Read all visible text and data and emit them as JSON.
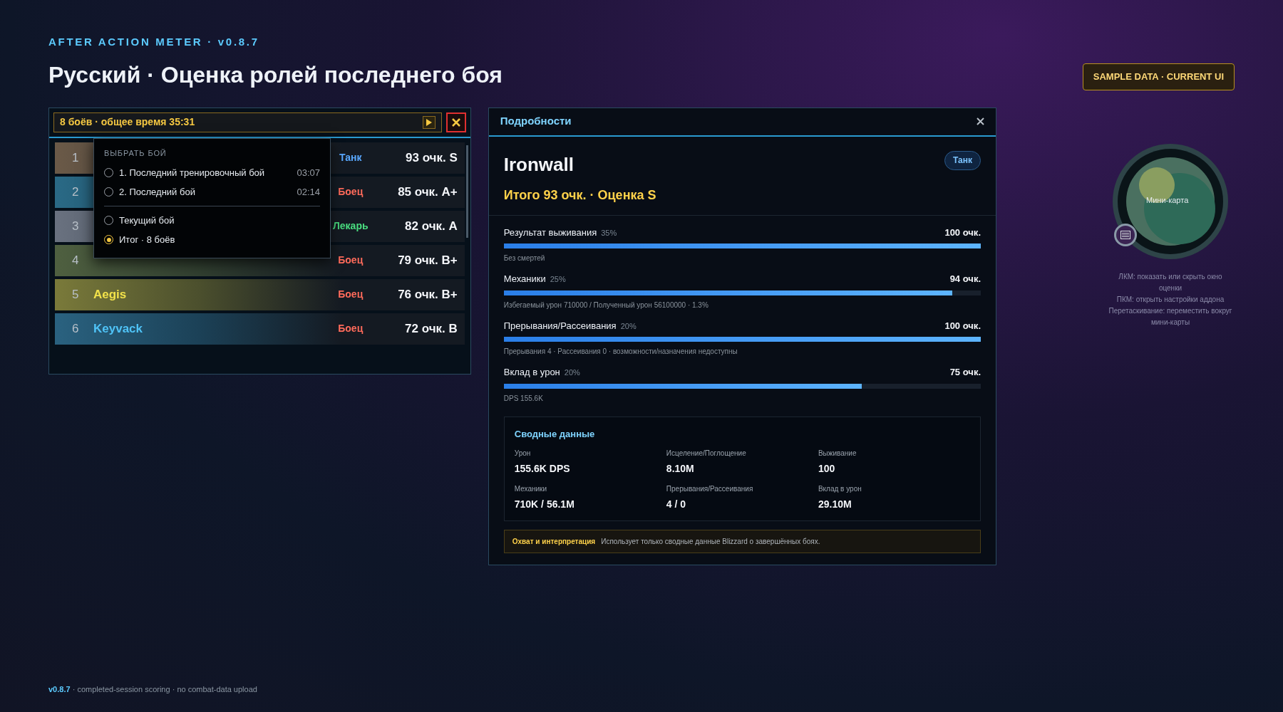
{
  "header": {
    "eyebrow": "AFTER ACTION METER · v0.8.7",
    "title": "Русский · Оценка ролей последнего боя",
    "badge": "SAMPLE DATA · CURRENT UI"
  },
  "meter": {
    "summary": "8 боёв · общее время 35:31",
    "rows": [
      {
        "rank": "1",
        "role": {
          "text": "Танк",
          "color": "#5aa9ff"
        },
        "score": "93 очк. S",
        "color": "#6b5a48"
      },
      {
        "rank": "2",
        "role": {
          "text": "Боец",
          "color": "#ff6b5b"
        },
        "score": "85 очк. A+",
        "color": "#2a6a86"
      },
      {
        "rank": "3",
        "role": {
          "text": "Лекарь",
          "color": "#4ade80"
        },
        "score": "82 очк. A",
        "color": "#6a7280"
      },
      {
        "rank": "4",
        "role": {
          "text": "Боец",
          "color": "#ff6b5b"
        },
        "score": "79 очк. B+",
        "color": "#4f6040"
      },
      {
        "rank": "5",
        "name": {
          "text": "Aegis",
          "color": "#f2e24a"
        },
        "role": {
          "text": "Боец",
          "color": "#ff6b5b"
        },
        "score": "76 очк. B+",
        "color": "#7a7a3a"
      },
      {
        "rank": "6",
        "name": {
          "text": "Keyvack",
          "color": "#4fc3f7"
        },
        "role": {
          "text": "Боец",
          "color": "#ff6b5b"
        },
        "score": "72 очк. B",
        "color": "#2a6280"
      }
    ],
    "dropdown": {
      "heading": "ВЫБРАТЬ БОЙ",
      "groups": [
        [
          {
            "label": "1. Последний тренировочный бой",
            "time": "03:07",
            "selected": false
          },
          {
            "label": "2. Последний бой",
            "time": "02:14",
            "selected": false
          }
        ],
        [
          {
            "label": "Текущий бой",
            "selected": false
          },
          {
            "label": "Итог · 8 боёв",
            "selected": true
          }
        ]
      ]
    }
  },
  "details": {
    "title": "Подробности",
    "player": "Ironwall",
    "role": "Танк",
    "total": "Итого 93 очк. · Оценка S",
    "metrics": [
      {
        "label": "Результат выживания",
        "weight": "35%",
        "score": "100 очк.",
        "level": 1,
        "note": "Без смертей"
      },
      {
        "label": "Механики",
        "weight": "25%",
        "score": "94 очк.",
        "level": 0.94,
        "note": "Избегаемый урон 710000 / Полученный урон 56100000 · 1.3%"
      },
      {
        "label": "Прерывания/Рассеивания",
        "weight": "20%",
        "score": "100 очк.",
        "level": 1,
        "note": "Прерывания 4 · Рассеивания 0 · возможности/назначения недоступны"
      },
      {
        "label": "Вклад в урон",
        "weight": "20%",
        "score": "75 очк.",
        "level": 0.75,
        "note": "DPS 155.6K"
      }
    ],
    "summary": {
      "title": "Сводные данные",
      "stats": [
        {
          "label": "Урон",
          "value": "155.6K DPS"
        },
        {
          "label": "Исцеление/Поглощение",
          "value": "8.10M"
        },
        {
          "label": "Выживание",
          "value": "100"
        },
        {
          "label": "Механики",
          "value": "710K / 56.1M"
        },
        {
          "label": "Прерывания/Рассеивания",
          "value": "4 / 0"
        },
        {
          "label": "Вклад в урон",
          "value": "29.10M"
        }
      ]
    },
    "scope": {
      "title": "Охват и интерпретация",
      "text": "Использует только сводные данные Blizzard о завершённых боях."
    }
  },
  "minimap": {
    "label": "Мини-карта",
    "hints": [
      "ЛКМ: показать или скрыть окно оценки",
      "ПКМ: открыть настройки аддона",
      "Перетаскивание: переместить вокруг мини-карты"
    ]
  },
  "footer": {
    "version": "v0.8.7",
    "text": "· completed-session scoring · no combat-data upload"
  }
}
